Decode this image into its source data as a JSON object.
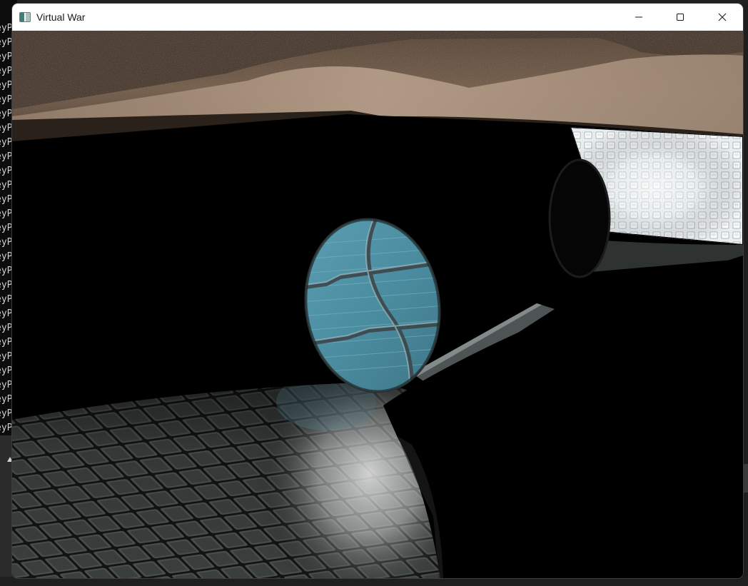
{
  "window": {
    "title": "Virtual War",
    "app_icon": "app-window-icon"
  },
  "controls": {
    "minimize_icon": "minimize-icon",
    "maximize_icon": "maximize-icon",
    "close_icon": "close-icon"
  },
  "console": {
    "lines": [
      "eyP",
      "eyP",
      "eyP",
      "eyP",
      "eyP",
      "eyP",
      "eyP",
      "eyP",
      "eyP",
      "eyP",
      "eyP",
      "eyP",
      "eyP",
      "eyP",
      "eyP",
      "eyP",
      "eyP",
      "eyP",
      "eyP",
      "eyP",
      "eyP",
      "eyP",
      "eyP",
      "eyP",
      "eyP",
      "eyP",
      "eyP",
      "eyP",
      "eyP"
    ]
  },
  "colors": {
    "sky_sand": "#7a6350",
    "floor_tile": "#3a3d3c",
    "cylinder_cap": "#4f8ea3",
    "background": "#000000"
  }
}
